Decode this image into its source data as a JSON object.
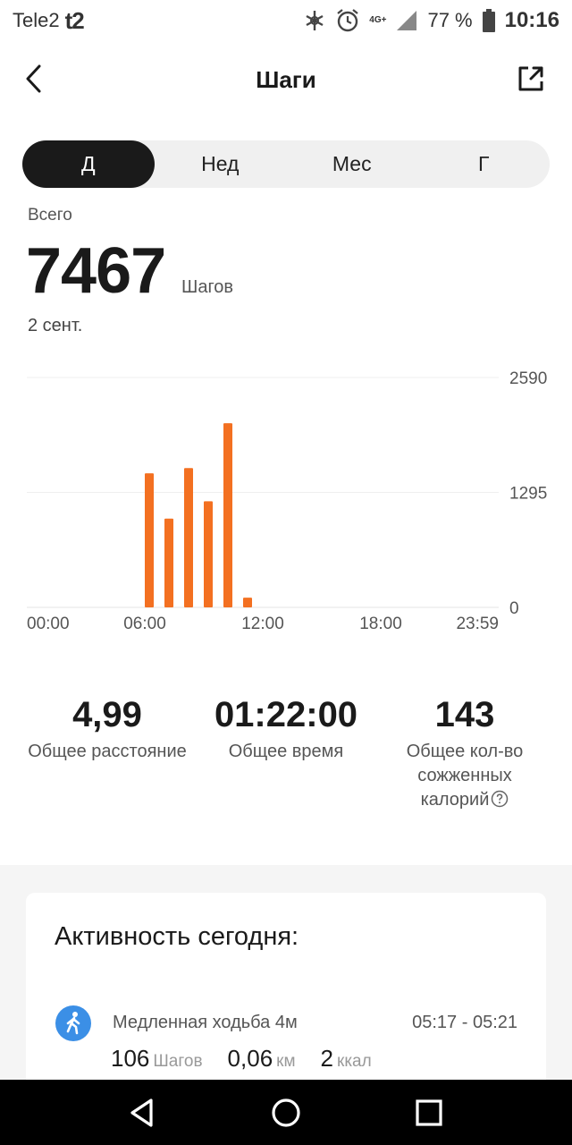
{
  "status_bar": {
    "carrier": "Tele2",
    "carrier_logo": "t2",
    "network": "4G+",
    "battery": "77 %",
    "time": "10:16",
    "icons": [
      "bluetooth-icon",
      "alarm-icon",
      "signal-icon",
      "battery-icon"
    ]
  },
  "header": {
    "title": "Шаги",
    "back_icon": "chevron-left-icon",
    "share_icon": "share-external-icon"
  },
  "period_tabs": [
    {
      "label": "Д",
      "active": true
    },
    {
      "label": "Нед",
      "active": false
    },
    {
      "label": "Мес",
      "active": false
    },
    {
      "label": "Г",
      "active": false
    }
  ],
  "summary": {
    "total_label": "Всего",
    "total_value": "7467",
    "unit": "Шагов",
    "date": "2 сент."
  },
  "chart_data": {
    "type": "bar",
    "x_ticks": [
      "00:00",
      "06:00",
      "12:00",
      "18:00",
      "23:59"
    ],
    "y_ticks": [
      "2590",
      "1295",
      "0"
    ],
    "ylim": [
      0,
      2590
    ],
    "bar_color": "#f37021",
    "bars": [
      {
        "hour": 6.0,
        "value": 1510
      },
      {
        "hour": 7.0,
        "value": 1000
      },
      {
        "hour": 8.0,
        "value": 1570
      },
      {
        "hour": 9.0,
        "value": 1195
      },
      {
        "hour": 10.0,
        "value": 2075
      },
      {
        "hour": 11.0,
        "value": 110
      }
    ]
  },
  "stats": [
    {
      "value": "4,99",
      "label": "Общее расстояние"
    },
    {
      "value": "01:22:00",
      "label": "Общее время"
    },
    {
      "value": "143",
      "label_lines": [
        "Общее кол-во",
        "сожженных",
        "калорий"
      ],
      "help_icon": "question-circle-icon"
    }
  ],
  "activity": {
    "title": "Активность сегодня:",
    "items": [
      {
        "icon": "walking-person-icon",
        "name": "Медленная ходьба 4м",
        "time": "05:17 - 05:21",
        "steps": "106",
        "steps_unit": "Шагов",
        "distance": "0,06",
        "distance_unit": "км",
        "calories": "2",
        "calories_unit": "ккал"
      }
    ]
  },
  "nav": [
    "back-triangle-icon",
    "home-circle-icon",
    "recents-square-icon"
  ]
}
